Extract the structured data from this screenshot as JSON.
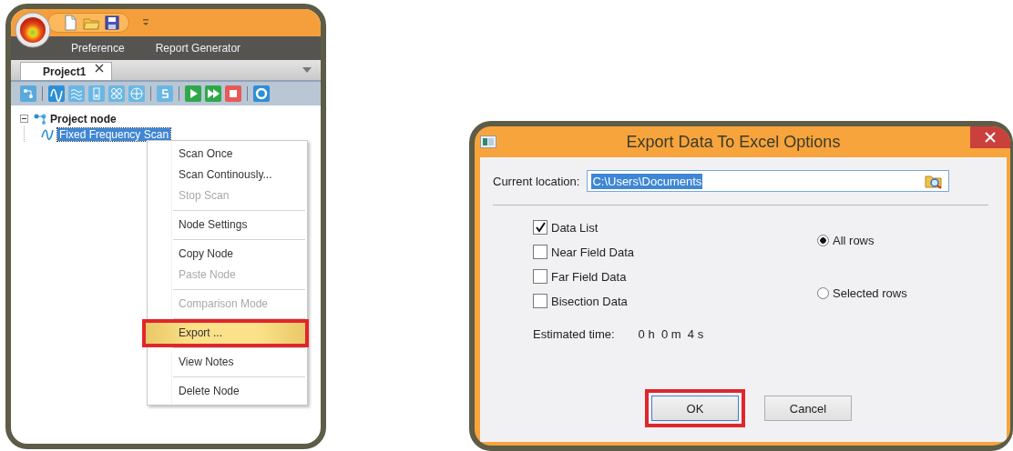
{
  "app": {
    "ribbon_tabs": [
      "Preference",
      "Report Generator"
    ],
    "doc_tabs": [
      {
        "label": "Project1",
        "selected": true
      }
    ],
    "tree": {
      "label": "Project node",
      "expanded": true,
      "children": [
        {
          "label": "Fixed Frequency Scan",
          "selected": true
        }
      ]
    },
    "context_menu": {
      "groups": [
        {
          "items": [
            {
              "label": "Scan Once",
              "disabled": false,
              "selected": false,
              "callout": false
            },
            {
              "label": "Scan Continously...",
              "disabled": false,
              "selected": false,
              "callout": false
            },
            {
              "label": "Stop Scan",
              "disabled": true,
              "selected": false,
              "callout": false
            }
          ]
        },
        {
          "items": [
            {
              "label": "Node Settings",
              "disabled": false,
              "selected": false,
              "callout": false
            }
          ]
        },
        {
          "items": [
            {
              "label": "Copy Node",
              "disabled": false,
              "selected": false,
              "callout": false
            },
            {
              "label": "Paste Node",
              "disabled": true,
              "selected": false,
              "callout": false
            }
          ]
        },
        {
          "items": [
            {
              "label": "Comparison Mode",
              "disabled": true,
              "selected": false,
              "callout": false
            }
          ]
        },
        {
          "items": [
            {
              "label": "Export ...",
              "disabled": false,
              "selected": true,
              "callout": true
            }
          ]
        },
        {
          "items": [
            {
              "label": "View Notes",
              "disabled": false,
              "selected": false,
              "callout": false
            }
          ]
        },
        {
          "items": [
            {
              "label": "Delete Node",
              "disabled": false,
              "selected": false,
              "callout": false
            }
          ]
        }
      ]
    }
  },
  "dialog": {
    "title": "Export Data To Excel Options",
    "location_label": "Current location:",
    "location_value": "C:\\Users\\Documents",
    "location_text_selected": true,
    "checkboxes": [
      {
        "label": "Data List",
        "checked": true
      },
      {
        "label": "Near Field Data",
        "checked": false
      },
      {
        "label": "Far Field Data",
        "checked": false
      },
      {
        "label": "Bisection Data",
        "checked": false
      }
    ],
    "radios": [
      {
        "label": "All rows",
        "selected": true
      },
      {
        "label": "Selected rows",
        "selected": false
      }
    ],
    "estimate_label": "Estimated time:",
    "estimate_value": "0 h  0 m  4 s",
    "buttons": [
      {
        "label": "OK",
        "focused": true,
        "callout": true
      },
      {
        "label": "Cancel",
        "focused": false,
        "callout": false
      }
    ]
  }
}
